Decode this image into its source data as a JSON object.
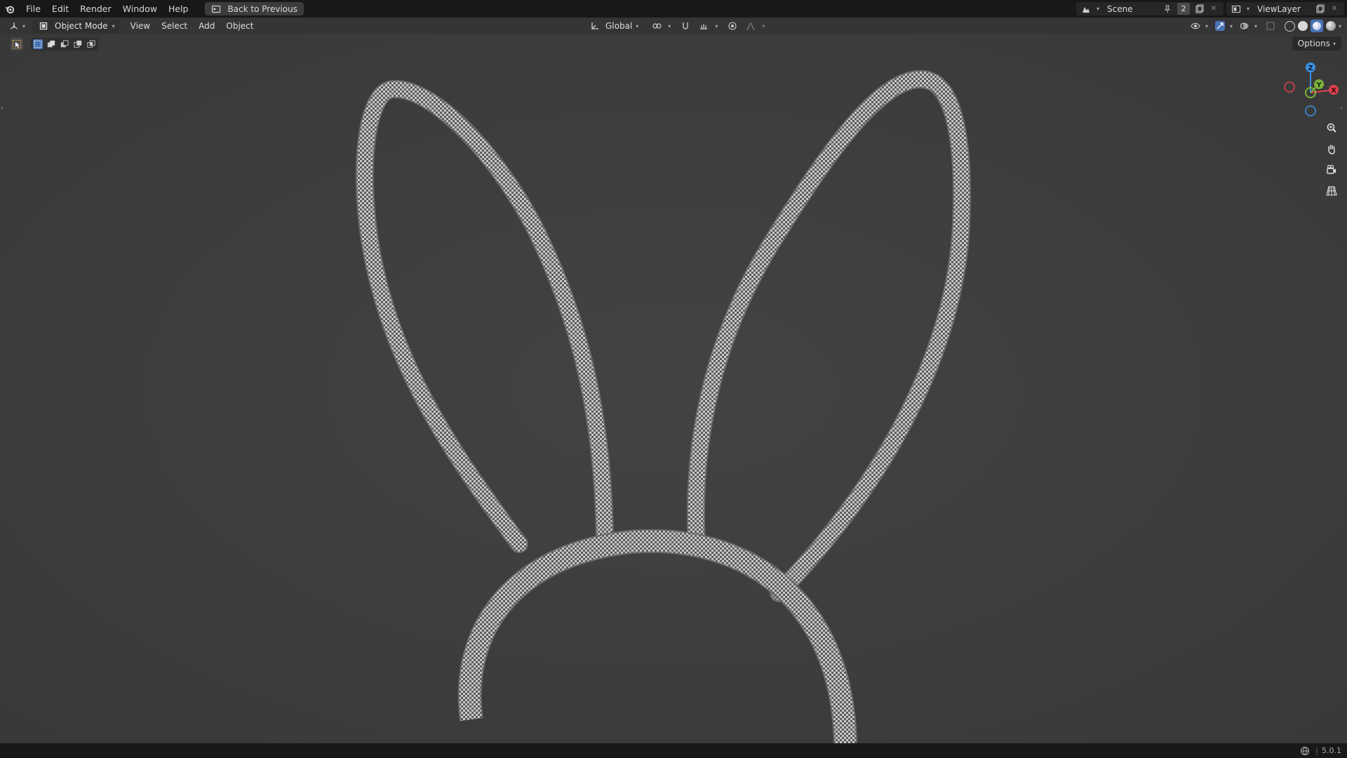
{
  "app": {
    "menu": [
      "File",
      "Edit",
      "Render",
      "Window",
      "Help"
    ],
    "back_button_label": "Back to Previous"
  },
  "scene": {
    "name": "Scene",
    "user_count": "2"
  },
  "view_layer": {
    "name": "ViewLayer"
  },
  "viewport_header": {
    "mode": "Object Mode",
    "menus": [
      "View",
      "Select",
      "Add",
      "Object"
    ],
    "transform_orientation": "Global"
  },
  "tool_row": {
    "options_label": "Options"
  },
  "gizmo": {
    "axes": {
      "x": "X",
      "y": "Y",
      "z": "Z"
    },
    "colors": {
      "x": "#e0414e",
      "y": "#7ab33a",
      "z": "#3c8fe0"
    }
  },
  "status": {
    "version": "5.0.1"
  },
  "colors": {
    "topbar_bg": "#181818",
    "viewport_bg": "#3d3d3d",
    "accent_blue": "#4772b3",
    "warning_orange": "#e8a34c"
  },
  "icons": {
    "logo": "blender-logo-icon",
    "back": "back-to-previous-icon",
    "editor_type": "3d-viewport-icon",
    "select_tool": "select-box-tool-icon",
    "zoom": "zoom-icon",
    "pan": "hand-icon",
    "camera": "camera-icon",
    "ortho": "grid-perspective-icon"
  }
}
